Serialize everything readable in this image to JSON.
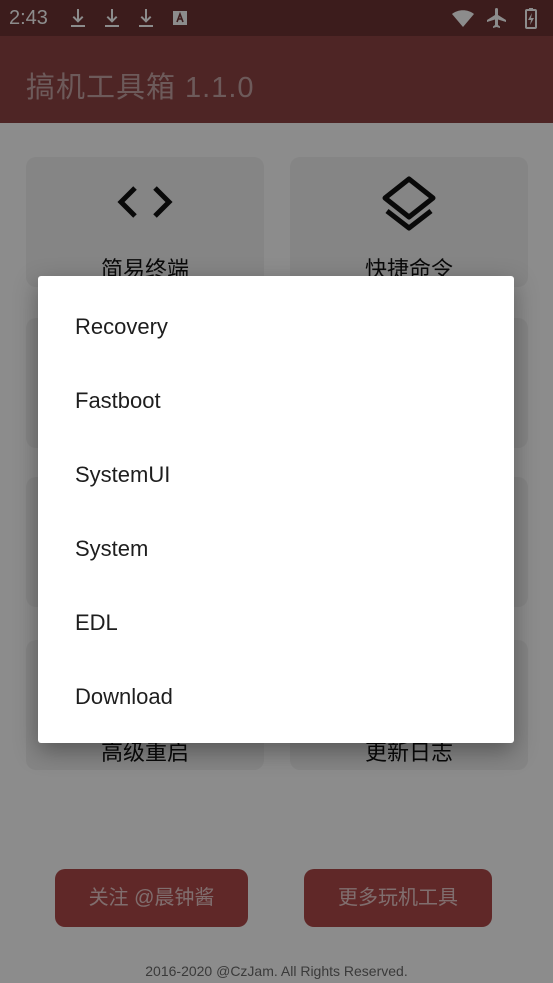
{
  "status_bar": {
    "time": "2:43",
    "left_icons": [
      "download-icon",
      "download-icon",
      "download-icon",
      "app-notification-icon"
    ],
    "right_icons": [
      "wifi-icon",
      "airplane-icon",
      "battery-charging-icon"
    ]
  },
  "app_bar": {
    "title": "搞机工具箱 1.1.0"
  },
  "tiles": [
    {
      "label": "简易终端",
      "icon": "code-brackets-icon"
    },
    {
      "label": "快捷命令",
      "icon": "layers-icon"
    },
    {
      "label": "高级重启",
      "icon": "restart-icon"
    },
    {
      "label": "更新日志",
      "icon": "changelog-icon"
    }
  ],
  "buttons": {
    "follow": "关注 @晨钟酱",
    "more_tools": "更多玩机工具"
  },
  "footer": "2016-2020 @CzJam. All Rights Reserved.",
  "dialog": {
    "items": [
      "Recovery",
      "Fastboot",
      "SystemUI",
      "System",
      "EDL",
      "Download"
    ]
  },
  "colors": {
    "status_bar": "#6e3434",
    "app_bar": "#8f4444",
    "button": "#b04a4a",
    "tile": "#f2f2f2"
  }
}
